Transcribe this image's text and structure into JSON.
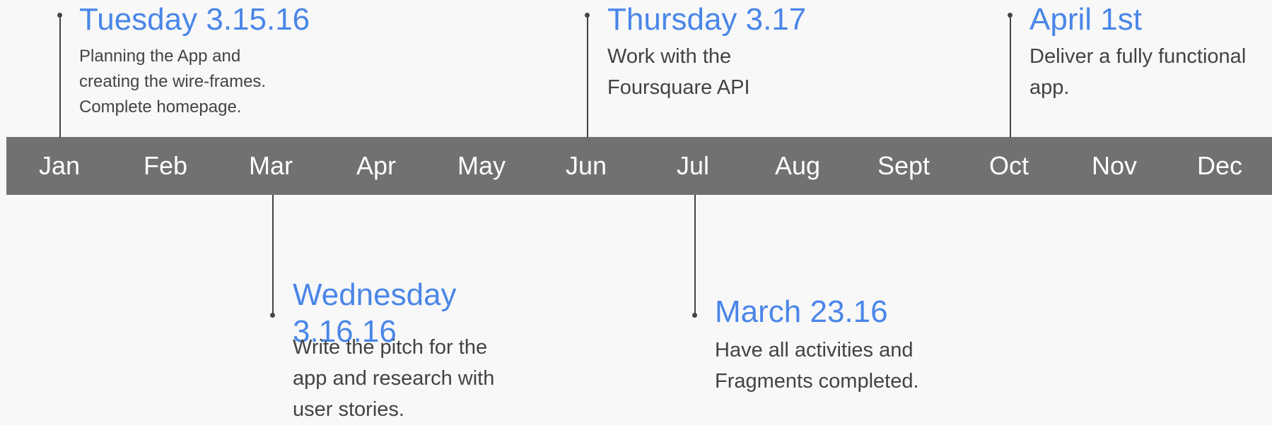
{
  "months": [
    "Jan",
    "Feb",
    "Mar",
    "Apr",
    "May",
    "Jun",
    "Jul",
    "Aug",
    "Sept",
    "Oct",
    "Nov",
    "Dec"
  ],
  "milestones": [
    {
      "title": "Tuesday 3.15.16",
      "description": "Planning the App and creating the wire-frames. Complete homepage."
    },
    {
      "title": "Thursday 3.17",
      "description": "Work with the Foursquare API"
    },
    {
      "title": "April 1st",
      "description": "Deliver a fully functional app."
    },
    {
      "title": "Wednesday 3.16.16",
      "description": "Write the pitch for the app and research with user stories."
    },
    {
      "title": "March 23.16",
      "description": "Have all activities and Fragments completed."
    }
  ],
  "colors": {
    "background": "#f8f8f8",
    "bar": "#717171",
    "month_text": "#ffffff",
    "title": "#4a86e8",
    "description": "#434343",
    "connector": "#444444"
  }
}
